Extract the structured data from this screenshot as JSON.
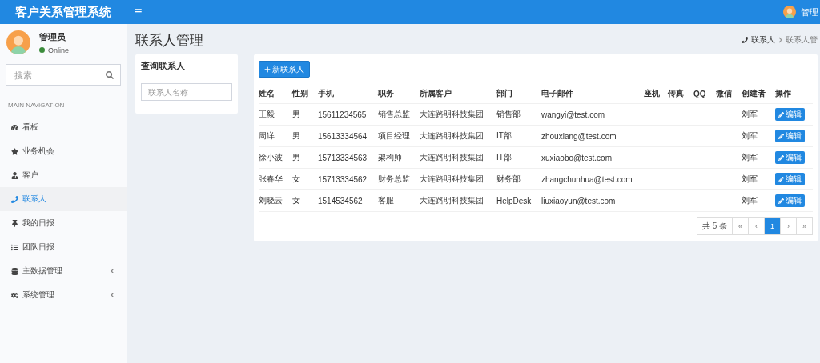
{
  "header": {
    "logo": "客户关系管理系统",
    "menu_glyph": "≡",
    "user": "管理"
  },
  "sidebar": {
    "user": {
      "name": "管理员",
      "status": "Online"
    },
    "search": {
      "placeholder": "搜索"
    },
    "section": "MAIN NAVIGATION",
    "items": [
      {
        "label": "看板",
        "selected": false,
        "expandable": false
      },
      {
        "label": "业务机会",
        "selected": false,
        "expandable": false
      },
      {
        "label": "客户",
        "selected": false,
        "expandable": false
      },
      {
        "label": "联系人",
        "selected": true,
        "expandable": false
      },
      {
        "label": "我的日报",
        "selected": false,
        "expandable": false
      },
      {
        "label": "团队日报",
        "selected": false,
        "expandable": false
      },
      {
        "label": "主数据管理",
        "selected": false,
        "expandable": true
      },
      {
        "label": "系统管理",
        "selected": false,
        "expandable": true
      }
    ]
  },
  "page": {
    "title": "联系人管理",
    "breadcrumb": [
      "联系人",
      "联系人管"
    ]
  },
  "query": {
    "title": "查询联系人",
    "placeholder": "联系人名称"
  },
  "table": {
    "new_button": "新联系人",
    "columns": [
      "姓名",
      "性别",
      "手机",
      "职务",
      "所属客户",
      "部门",
      "电子邮件",
      "座机",
      "传真",
      "QQ",
      "微信",
      "创建者",
      "操作"
    ],
    "rows": [
      {
        "cells": [
          "王毅",
          "男",
          "15611234565",
          "销售总监",
          "大连路明科技集团",
          "销售部",
          "wangyi@test.com",
          "",
          "",
          "",
          "",
          "刘军"
        ],
        "action": "编辑"
      },
      {
        "cells": [
          "周详",
          "男",
          "15613334564",
          "项目经理",
          "大连路明科技集团",
          "IT部",
          "zhouxiang@test.com",
          "",
          "",
          "",
          "",
          "刘军"
        ],
        "action": "编辑"
      },
      {
        "cells": [
          "徐小波",
          "男",
          "15713334563",
          "架构师",
          "大连路明科技集团",
          "IT部",
          "xuxiaobo@test.com",
          "",
          "",
          "",
          "",
          "刘军"
        ],
        "action": "编辑"
      },
      {
        "cells": [
          "张春华",
          "女",
          "15713334562",
          "财务总监",
          "大连路明科技集团",
          "财务部",
          "zhangchunhua@test.com",
          "",
          "",
          "",
          "",
          "刘军"
        ],
        "action": "编辑"
      },
      {
        "cells": [
          "刘晓云",
          "女",
          "1514534562",
          "客服",
          "大连路明科技集团",
          "HelpDesk",
          "liuxiaoyun@test.com",
          "",
          "",
          "",
          "",
          "刘军"
        ],
        "action": "编辑"
      }
    ],
    "total": "共 5 条",
    "pages": [
      {
        "label": "«",
        "selected": false
      },
      {
        "label": "‹",
        "selected": false
      },
      {
        "label": "1",
        "selected": true
      },
      {
        "label": "›",
        "selected": false
      },
      {
        "label": "»",
        "selected": false
      }
    ]
  }
}
